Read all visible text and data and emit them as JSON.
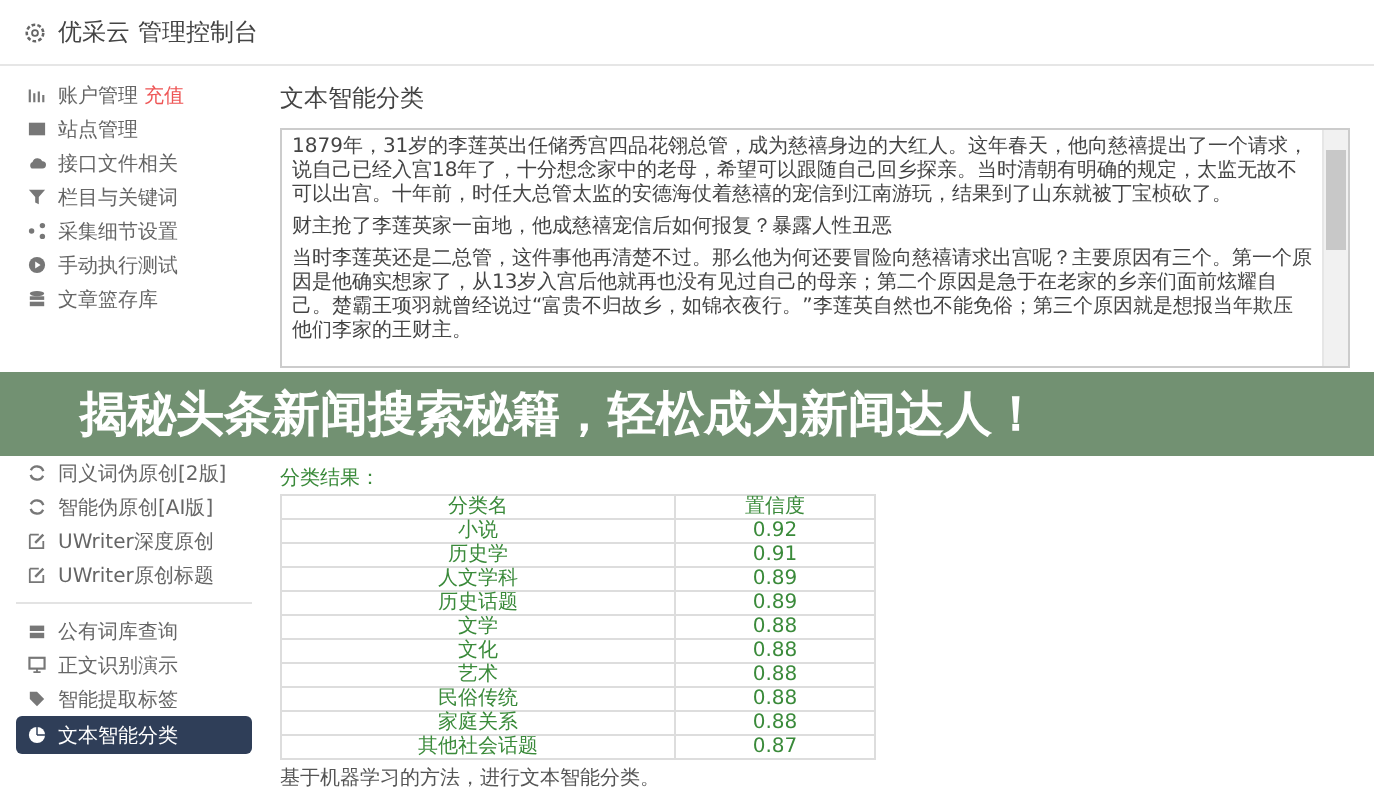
{
  "header": {
    "title": "优采云 管理控制台"
  },
  "sidebar": {
    "sections": [
      {
        "divider": false,
        "items": [
          {
            "label": "账户管理",
            "badge": "充值",
            "selected": false
          },
          {
            "label": "站点管理",
            "selected": false
          },
          {
            "label": "接口文件相关",
            "selected": false
          },
          {
            "label": "栏目与关键词",
            "selected": false
          },
          {
            "label": "采集细节设置",
            "selected": false
          },
          {
            "label": "手动执行测试",
            "selected": false
          },
          {
            "label": "文章篮存库",
            "selected": false
          }
        ]
      },
      {
        "divider": false,
        "items": [
          {
            "label": "同义词伪原创[2版]",
            "selected": false
          },
          {
            "label": "智能伪原创[AI版]",
            "selected": false
          },
          {
            "label": "UWriter深度原创",
            "selected": false
          },
          {
            "label": "UWriter原创标题",
            "selected": false
          }
        ]
      },
      {
        "divider": true,
        "items": [
          {
            "label": "公有词库查询",
            "selected": false
          },
          {
            "label": "正文识别演示",
            "selected": false
          },
          {
            "label": "智能提取标签",
            "selected": false
          },
          {
            "label": "文本智能分类",
            "selected": true
          }
        ]
      }
    ]
  },
  "main": {
    "heading": "文本智能分类",
    "text_area": {
      "paragraphs": [
        "1879年，31岁的李莲英出任储秀宫四品花翎总管，成为慈禧身边的大红人。这年春天，他向慈禧提出了一个请求，说自己已经入宫18年了，十分想念家中的老母，希望可以跟随自己回乡探亲。当时清朝有明确的规定，太监无故不可以出宫。十年前，时任大总管太监的安德海仗着慈禧的宠信到江南游玩，结果到了山东就被丁宝桢砍了。",
        "财主抢了李莲英家一亩地，他成慈禧宠信后如何报复？暴露人性丑恶",
        "当时李莲英还是二总管，这件事他再清楚不过。那么他为何还要冒险向慈禧请求出宫呢？主要原因有三个。第一个原因是他确实想家了，从13岁入宫后他就再也没有见过自己的母亲；第二个原因是急于在老家的乡亲们面前炫耀自己。楚霸王项羽就曾经说过“富贵不归故乡，如锦衣夜行。”李莲英自然也不能免俗；第三个原因就是想报当年欺压他们李家的王财主。"
      ]
    },
    "result_label": "分类结果：",
    "table": {
      "columns": [
        "分类名",
        "置信度"
      ],
      "rows": [
        [
          "小说",
          "0.92"
        ],
        [
          "历史学",
          "0.91"
        ],
        [
          "人文学科",
          "0.89"
        ],
        [
          "历史话题",
          "0.89"
        ],
        [
          "文学",
          "0.88"
        ],
        [
          "文化",
          "0.88"
        ],
        [
          "艺术",
          "0.88"
        ],
        [
          "民俗传统",
          "0.88"
        ],
        [
          "家庭关系",
          "0.88"
        ],
        [
          "其他社会话题",
          "0.87"
        ]
      ]
    },
    "footer_note": "基于机器学习的方法，进行文本智能分类。"
  },
  "banner": {
    "text": "揭秘头条新闻搜索秘籍，轻松成为新闻达人！"
  }
}
